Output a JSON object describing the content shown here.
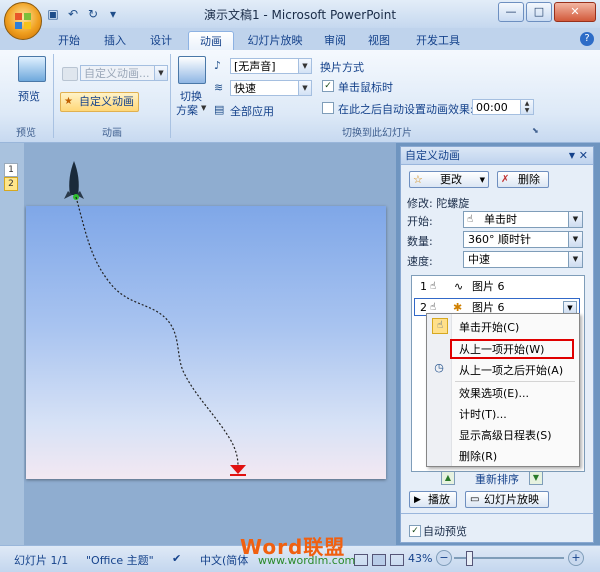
{
  "window": {
    "title": "演示文稿1 - Microsoft PowerPoint",
    "minimize_glyph": "—",
    "maximize_glyph": "□",
    "close_glyph": "✕"
  },
  "quick_access": {
    "icons": [
      "save-icon",
      "undo-icon",
      "redo-icon",
      "customize-icon"
    ]
  },
  "tabs": [
    {
      "label": "开始",
      "active": false
    },
    {
      "label": "插入",
      "active": false
    },
    {
      "label": "设计",
      "active": false
    },
    {
      "label": "动画",
      "active": true
    },
    {
      "label": "幻灯片放映",
      "active": false
    },
    {
      "label": "审阅",
      "active": false
    },
    {
      "label": "视图",
      "active": false
    },
    {
      "label": "开发工具",
      "active": false
    }
  ],
  "ribbon": {
    "preview_group": {
      "button": "预览",
      "label": "预览"
    },
    "animation_group": {
      "custom_combo": "自定义动画...",
      "custom_button": "自定义动画",
      "label": "动画"
    },
    "transition_group": {
      "scheme_button_line1": "切换",
      "scheme_button_line2": "方案",
      "sound_value": "[无声音]",
      "speed_value": "快速",
      "apply_all": "全部应用",
      "advance_title": "换片方式",
      "on_click": "单击鼠标时",
      "on_click_checked": true,
      "auto_after": "在此之后自动设置动画效果:",
      "auto_after_checked": false,
      "auto_time": "00:00",
      "label": "切换到此幻灯片"
    }
  },
  "thumbnails": [
    "1",
    "2"
  ],
  "task_pane": {
    "title": "自定义动画",
    "change_button": "更改",
    "delete_button": "删除",
    "modify_label": "修改: 陀螺旋",
    "start_label": "开始:",
    "start_value": "单击时",
    "amount_label": "数量:",
    "amount_value": "360°  顺时针",
    "speed_label": "速度:",
    "speed_value": "中速",
    "items": [
      {
        "index": "1",
        "name": "图片 6"
      },
      {
        "index": "2",
        "name": "图片 6"
      }
    ],
    "reorder_label": "重新排序",
    "play_button": "播放",
    "slideshow_button": "幻灯片放映",
    "autopreview_label": "自动预览",
    "autopreview_checked": true
  },
  "context_menu": [
    "单击开始(C)",
    "从上一项开始(W)",
    "从上一项之后开始(A)",
    "效果选项(E)...",
    "计时(T)...",
    "显示高级日程表(S)",
    "删除(R)"
  ],
  "status_bar": {
    "slide_info": "幻灯片 1/1",
    "theme": "\"Office 主题\"",
    "language": "中文(简体",
    "zoom": "43%"
  },
  "watermark": {
    "brand": "Word联盟",
    "url": "www.wordlm.com"
  },
  "colors": {
    "accent": "#15428b",
    "highlight_box": "#e00000",
    "watermark": "#f06010"
  }
}
